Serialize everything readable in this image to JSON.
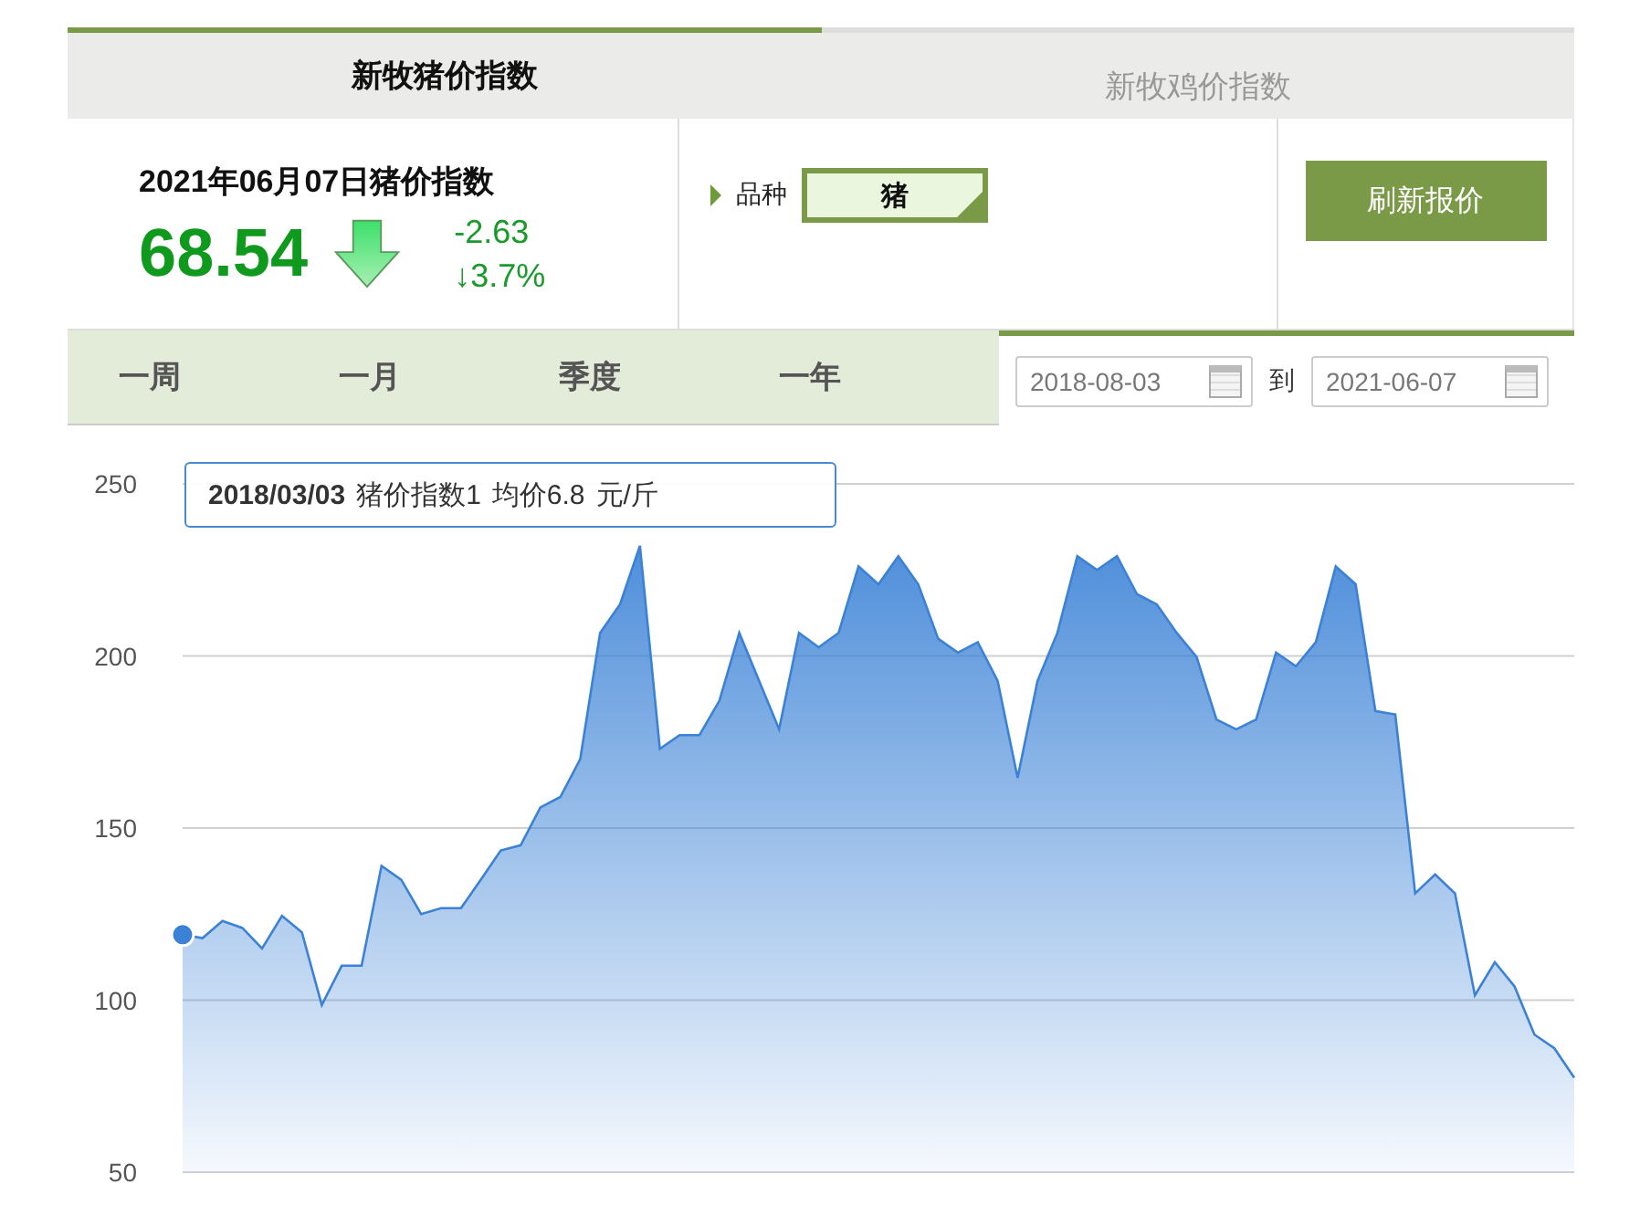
{
  "tabs": [
    {
      "label": "新牧猪价指数",
      "selected": true
    },
    {
      "label": "新牧鸡价指数",
      "selected": false
    }
  ],
  "summary": {
    "title": "2021年06月07日猪价指数",
    "value": "68.54",
    "falling": true,
    "change": "-2.63",
    "percent": "↓3.7%"
  },
  "variety": {
    "label": "品种",
    "value": "猪"
  },
  "refresh_button": "刷新报价",
  "periods": [
    "一周",
    "一月",
    "季度",
    "一年"
  ],
  "date_range": {
    "start": "2018-08-03",
    "separator": "到",
    "end": "2021-06-07"
  },
  "chart": {
    "tooltip": [
      "2018/03/03",
      "猪价指数1",
      "均价6.8",
      "元/斤"
    ],
    "chart_data": {
      "type": "area",
      "grid": true,
      "ylim": [
        50,
        250
      ],
      "yticks": [
        50,
        100,
        150,
        200,
        250
      ],
      "categories": [
        null,
        null,
        null,
        null,
        null,
        null,
        null,
        null,
        null,
        null,
        null,
        null,
        null,
        null,
        null,
        null,
        null,
        null,
        null,
        null,
        null,
        null,
        null,
        null,
        null,
        null,
        null,
        null,
        null,
        null,
        null,
        null,
        null,
        null,
        null,
        null,
        null,
        null,
        null,
        null,
        null,
        null,
        null,
        null,
        null,
        null,
        null,
        null,
        null,
        null,
        null,
        null,
        null,
        null,
        null,
        null,
        null,
        null,
        null,
        null,
        null,
        null,
        null,
        null,
        null,
        null,
        null,
        null,
        null,
        null,
        null
      ],
      "color": "#3b82d6",
      "values": [
        119,
        118,
        123,
        121,
        115,
        124.5,
        119.7,
        98.6,
        110,
        110,
        139,
        135,
        125,
        126.7,
        126.7,
        135,
        143.5,
        145,
        156,
        159,
        170,
        206.7,
        215,
        232,
        173,
        177,
        177,
        187,
        206.7,
        null,
        178.7,
        206.7,
        202.5,
        206.7,
        226,
        220.8,
        229,
        220.8,
        205,
        201,
        204,
        192.7,
        164.6,
        192.7,
        206.7,
        229,
        225,
        229,
        218,
        215,
        206.7,
        199.7,
        181.5,
        178.7,
        181.5,
        201,
        197,
        204,
        226,
        220.8,
        184,
        183,
        131,
        136.5,
        131,
        101.4,
        111,
        104,
        90,
        86,
        77.5
      ]
    }
  }
}
